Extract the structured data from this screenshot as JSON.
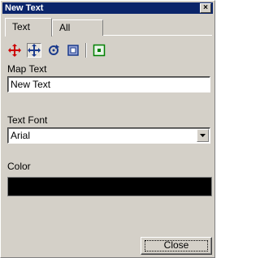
{
  "window": {
    "title": "New Text",
    "close_glyph": "×"
  },
  "tabs": [
    {
      "label": "Text",
      "active": true
    },
    {
      "label": "All",
      "active": false
    }
  ],
  "toolbar": {
    "tools": [
      {
        "icon": "move-icon",
        "color": "#cc0000"
      },
      {
        "icon": "pan-icon",
        "pressed": true
      },
      {
        "icon": "rotate-icon"
      },
      {
        "icon": "scale-icon"
      },
      {
        "icon": "frame-icon",
        "color": "#008000"
      }
    ]
  },
  "map_text": {
    "label": "Map Text",
    "value": "New Text"
  },
  "text_font": {
    "label": "Text Font",
    "value": "Arial"
  },
  "color": {
    "label": "Color",
    "value": "#000000"
  },
  "close_button": {
    "label": "Close"
  }
}
